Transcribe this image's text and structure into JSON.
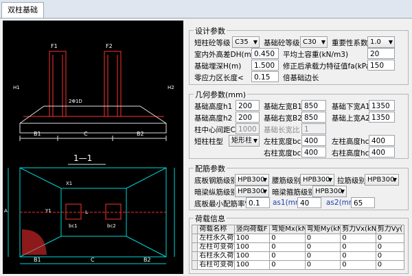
{
  "tab": {
    "label": "双柱基础"
  },
  "drawing": {
    "section_label": "1—1",
    "marks": [
      "F1",
      "F2",
      "12",
      "A",
      "2Φ1D",
      "B1",
      "C",
      "B2",
      "X1",
      "Y1",
      "L",
      "bc1",
      "bc2",
      "hc1",
      "hc2",
      "H1",
      "H2"
    ]
  },
  "design": {
    "title": "设计参数",
    "col_grade_label": "短柱砼等级",
    "col_grade_value": "C35",
    "base_grade_label": "基础砼等级",
    "base_grade_value": "C30",
    "importance_label": "重要性系数",
    "importance_value": "1.0",
    "dh_label": "室内外高差DH(m)",
    "dh_value": "0.450",
    "soil_label": "平均土容重(kN/m3)",
    "soil_value": "20",
    "depth_label": "基础埋深H(m)",
    "depth_value": "1.500",
    "fa_label": "修正后承载力特征值fa(kPa)",
    "fa_value": "150",
    "zero_label": "零应力区长度<",
    "zero_value": "0.15",
    "zero_suffix": "倍基础边长"
  },
  "geometry": {
    "title": "几何参数(mm)",
    "h1_label": "基础高度h1",
    "h1_value": "200",
    "b1_label": "基础左宽B1",
    "b1_value": "850",
    "a1_label": "基础下宽A1",
    "a1_value": "1350",
    "h2_label": "基础高度h2",
    "h2_value": "200",
    "b2_label": "基础右宽B2",
    "b2_value": "850",
    "a2_label": "基础上宽A2",
    "a2_value": "1350",
    "c_label": "柱中心间距C",
    "c_value": "1000",
    "ratio_label": "基础长宽比",
    "ratio_value": "1",
    "coltype_label": "短柱柱型",
    "coltype_value": "矩形柱",
    "bc1_label": "左柱宽度bc1",
    "bc1_value": "400",
    "hc1_label": "左柱高度hc1",
    "hc1_value": "400",
    "bc2_label": "右柱宽度bc2",
    "bc2_value": "400",
    "hc2_label": "右柱高度hc2",
    "hc2_value": "400"
  },
  "rebar": {
    "title": "配筋参数",
    "bottom_label": "底板钢筋级别",
    "bottom_value": "HPB300",
    "waist_label": "腰筋级别",
    "waist_value": "HPB300",
    "tie_label": "拉筋级别",
    "tie_value": "HPB300",
    "beam_long_label": "暗梁纵筋级别",
    "beam_long_value": "HPB300",
    "beam_stir_label": "暗梁箍筋级别",
    "beam_stir_value": "HPB300",
    "min_ratio_label": "底板最小配筋率%",
    "min_ratio_value": "0.1",
    "as1_label": "as1(mm)",
    "as1_value": "40",
    "as2_label": "as2(mm)",
    "as2_value": "65"
  },
  "loads": {
    "title": "荷载信息",
    "headers": [
      "荷载名称",
      "竖向荷载F",
      "弯矩Mx(kN*",
      "弯矩My(kN*",
      "剪力Vx(kN)",
      "剪力Vy("
    ],
    "rows": [
      [
        "左柱永久荷载",
        "100",
        "0",
        "0",
        "0",
        "0"
      ],
      [
        "左柱可变荷载",
        "100",
        "0",
        "0",
        "0",
        "0"
      ],
      [
        "右柱永久荷载",
        "100",
        "0",
        "0",
        "0",
        "0"
      ],
      [
        "右柱可变荷载",
        "100",
        "0",
        "0",
        "0",
        "0"
      ]
    ]
  }
}
